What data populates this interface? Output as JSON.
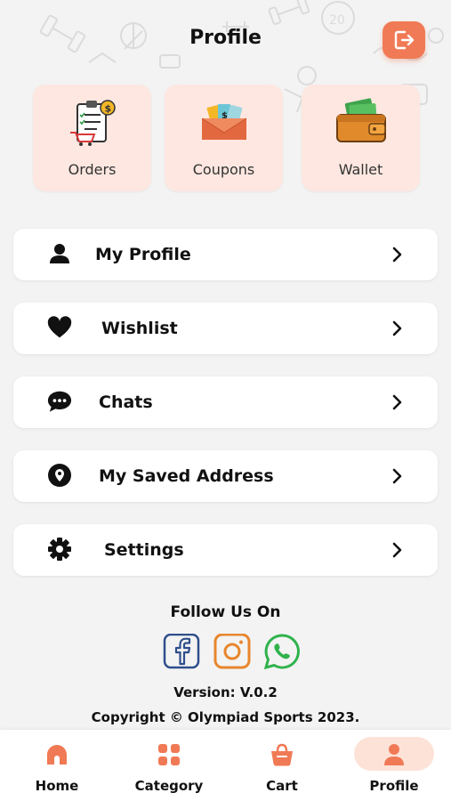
{
  "colors": {
    "accent": "#f07a55",
    "tile_bg": "#fde7e0",
    "page_bg": "#f3f3f3",
    "card_bg": "#ffffff"
  },
  "header": {
    "title": "Profile",
    "logout_icon": "logout-icon"
  },
  "tiles": [
    {
      "label": "Orders",
      "icon": "orders-clipboard-icon"
    },
    {
      "label": "Coupons",
      "icon": "coupons-envelope-icon"
    },
    {
      "label": "Wallet",
      "icon": "wallet-icon"
    }
  ],
  "menu": [
    {
      "label": "My Profile",
      "icon": "user-icon"
    },
    {
      "label": "Wishlist",
      "icon": "heart-icon"
    },
    {
      "label": "Chats",
      "icon": "chat-bubble-icon"
    },
    {
      "label": "My Saved Address",
      "icon": "location-pin-icon"
    },
    {
      "label": "Settings",
      "icon": "gear-icon"
    }
  ],
  "footer": {
    "follow_label": "Follow Us On",
    "social": [
      "facebook-icon",
      "instagram-icon",
      "whatsapp-icon"
    ],
    "version": "Version: V.0.2",
    "copyright": "Copyright © Olympiad Sports 2023."
  },
  "bottom_nav": {
    "items": [
      {
        "label": "Home",
        "icon": "home-icon",
        "active": false
      },
      {
        "label": "Category",
        "icon": "grid-icon",
        "active": false
      },
      {
        "label": "Cart",
        "icon": "basket-icon",
        "active": false
      },
      {
        "label": "Profile",
        "icon": "user-icon",
        "active": true
      }
    ]
  }
}
